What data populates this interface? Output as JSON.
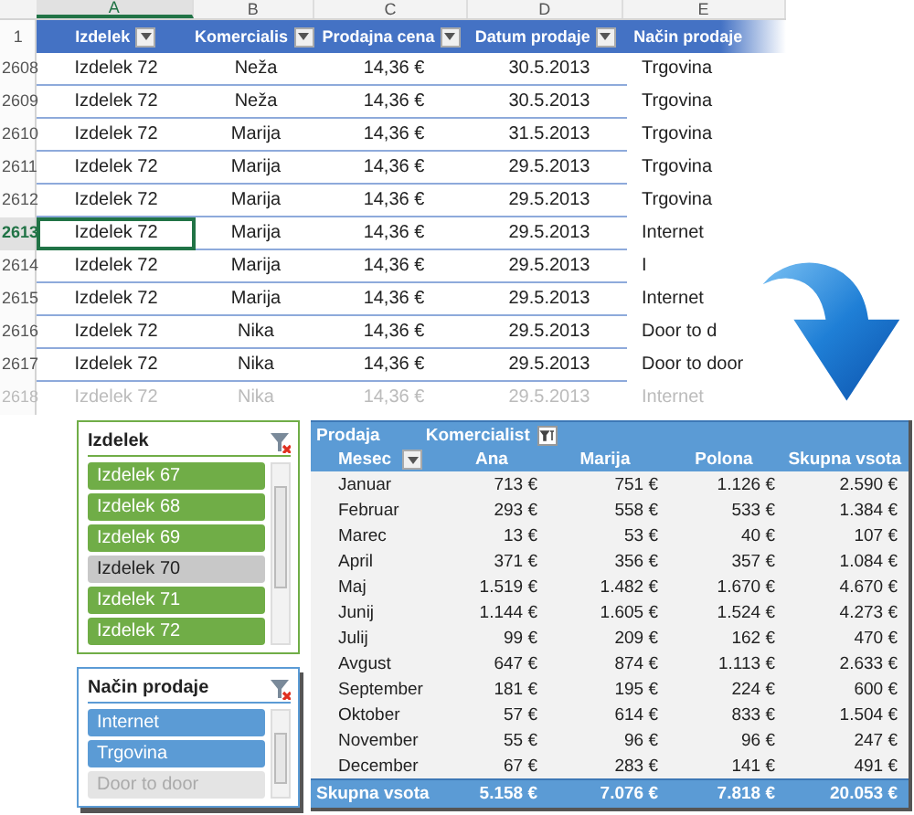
{
  "sheet": {
    "column_letters": [
      "A",
      "B",
      "C",
      "D",
      "E"
    ],
    "header_row": "1",
    "columns": [
      "Izdelek",
      "Komercialis",
      "Prodajna cena",
      "Datum prodaje",
      "Način prodaje"
    ],
    "rows": [
      {
        "number": "2608",
        "selected": false,
        "cells": [
          "Izdelek 72",
          "Neža",
          "14,36 €",
          "30.5.2013",
          "Trgovina"
        ]
      },
      {
        "number": "2609",
        "selected": false,
        "cells": [
          "Izdelek 72",
          "Neža",
          "14,36 €",
          "30.5.2013",
          "Trgovina"
        ]
      },
      {
        "number": "2610",
        "selected": false,
        "cells": [
          "Izdelek 72",
          "Marija",
          "14,36 €",
          "31.5.2013",
          "Trgovina"
        ]
      },
      {
        "number": "2611",
        "selected": false,
        "cells": [
          "Izdelek 72",
          "Marija",
          "14,36 €",
          "29.5.2013",
          "Trgovina"
        ]
      },
      {
        "number": "2612",
        "selected": false,
        "cells": [
          "Izdelek 72",
          "Marija",
          "14,36 €",
          "29.5.2013",
          "Trgovina"
        ]
      },
      {
        "number": "2613",
        "selected": true,
        "cells": [
          "Izdelek 72",
          "Marija",
          "14,36 €",
          "29.5.2013",
          "Internet"
        ]
      },
      {
        "number": "2614",
        "selected": false,
        "cells": [
          "Izdelek 72",
          "Marija",
          "14,36 €",
          "29.5.2013",
          "I"
        ]
      },
      {
        "number": "2615",
        "selected": false,
        "cells": [
          "Izdelek 72",
          "Marija",
          "14,36 €",
          "29.5.2013",
          "Internet"
        ]
      },
      {
        "number": "2616",
        "selected": false,
        "cells": [
          "Izdelek 72",
          "Nika",
          "14,36 €",
          "29.5.2013",
          "Door to d"
        ]
      },
      {
        "number": "2617",
        "selected": false,
        "cells": [
          "Izdelek 72",
          "Nika",
          "14,36 €",
          "29.5.2013",
          "Door to door"
        ]
      },
      {
        "number": "2618",
        "selected": false,
        "cells": [
          "Izdelek 72",
          "Nika",
          "14,36 €",
          "29.5.2013",
          "Internet"
        ]
      }
    ]
  },
  "slicers": [
    {
      "title": "Izdelek",
      "color": "#70ad47",
      "items": [
        {
          "label": "Izdelek 67",
          "selected": true,
          "available": true
        },
        {
          "label": "Izdelek 68",
          "selected": true,
          "available": true
        },
        {
          "label": "Izdelek 69",
          "selected": true,
          "available": true
        },
        {
          "label": "Izdelek 70",
          "selected": false,
          "available": true
        },
        {
          "label": "Izdelek 71",
          "selected": true,
          "available": true
        },
        {
          "label": "Izdelek 72",
          "selected": true,
          "available": true
        }
      ]
    },
    {
      "title": "Način prodaje",
      "color": "#5b9bd5",
      "items": [
        {
          "label": "Internet",
          "selected": true,
          "available": true
        },
        {
          "label": "Trgovina",
          "selected": true,
          "available": true
        },
        {
          "label": "Door to door",
          "selected": false,
          "available": false
        }
      ]
    }
  ],
  "pivot": {
    "value_label": "Prodaja",
    "column_field": "Komercialist",
    "row_field": "Mesec",
    "columns": [
      "Ana",
      "Marija",
      "Polona",
      "Skupna vsota"
    ],
    "rows": [
      {
        "label": "Januar",
        "values": [
          "713 €",
          "751 €",
          "1.126 €",
          "2.590 €"
        ]
      },
      {
        "label": "Februar",
        "values": [
          "293 €",
          "558 €",
          "533 €",
          "1.384 €"
        ]
      },
      {
        "label": "Marec",
        "values": [
          "13 €",
          "53 €",
          "40 €",
          "107 €"
        ]
      },
      {
        "label": "April",
        "values": [
          "371 €",
          "356 €",
          "357 €",
          "1.084 €"
        ]
      },
      {
        "label": "Maj",
        "values": [
          "1.519 €",
          "1.482 €",
          "1.670 €",
          "4.670 €"
        ]
      },
      {
        "label": "Junij",
        "values": [
          "1.144 €",
          "1.605 €",
          "1.524 €",
          "4.273 €"
        ]
      },
      {
        "label": "Julij",
        "values": [
          "99 €",
          "209 €",
          "162 €",
          "470 €"
        ]
      },
      {
        "label": "Avgust",
        "values": [
          "647 €",
          "874 €",
          "1.113 €",
          "2.633 €"
        ]
      },
      {
        "label": "September",
        "values": [
          "181 €",
          "195 €",
          "224 €",
          "600 €"
        ]
      },
      {
        "label": "Oktober",
        "values": [
          "57 €",
          "614 €",
          "833 €",
          "1.504 €"
        ]
      },
      {
        "label": "November",
        "values": [
          "55 €",
          "96 €",
          "96 €",
          "247 €"
        ]
      },
      {
        "label": "December",
        "values": [
          "67 €",
          "283 €",
          "141 €",
          "491 €"
        ]
      }
    ],
    "total": {
      "label": "Skupna vsota",
      "values": [
        "5.158 €",
        "7.076 €",
        "7.818 €",
        "20.053 €"
      ]
    }
  }
}
